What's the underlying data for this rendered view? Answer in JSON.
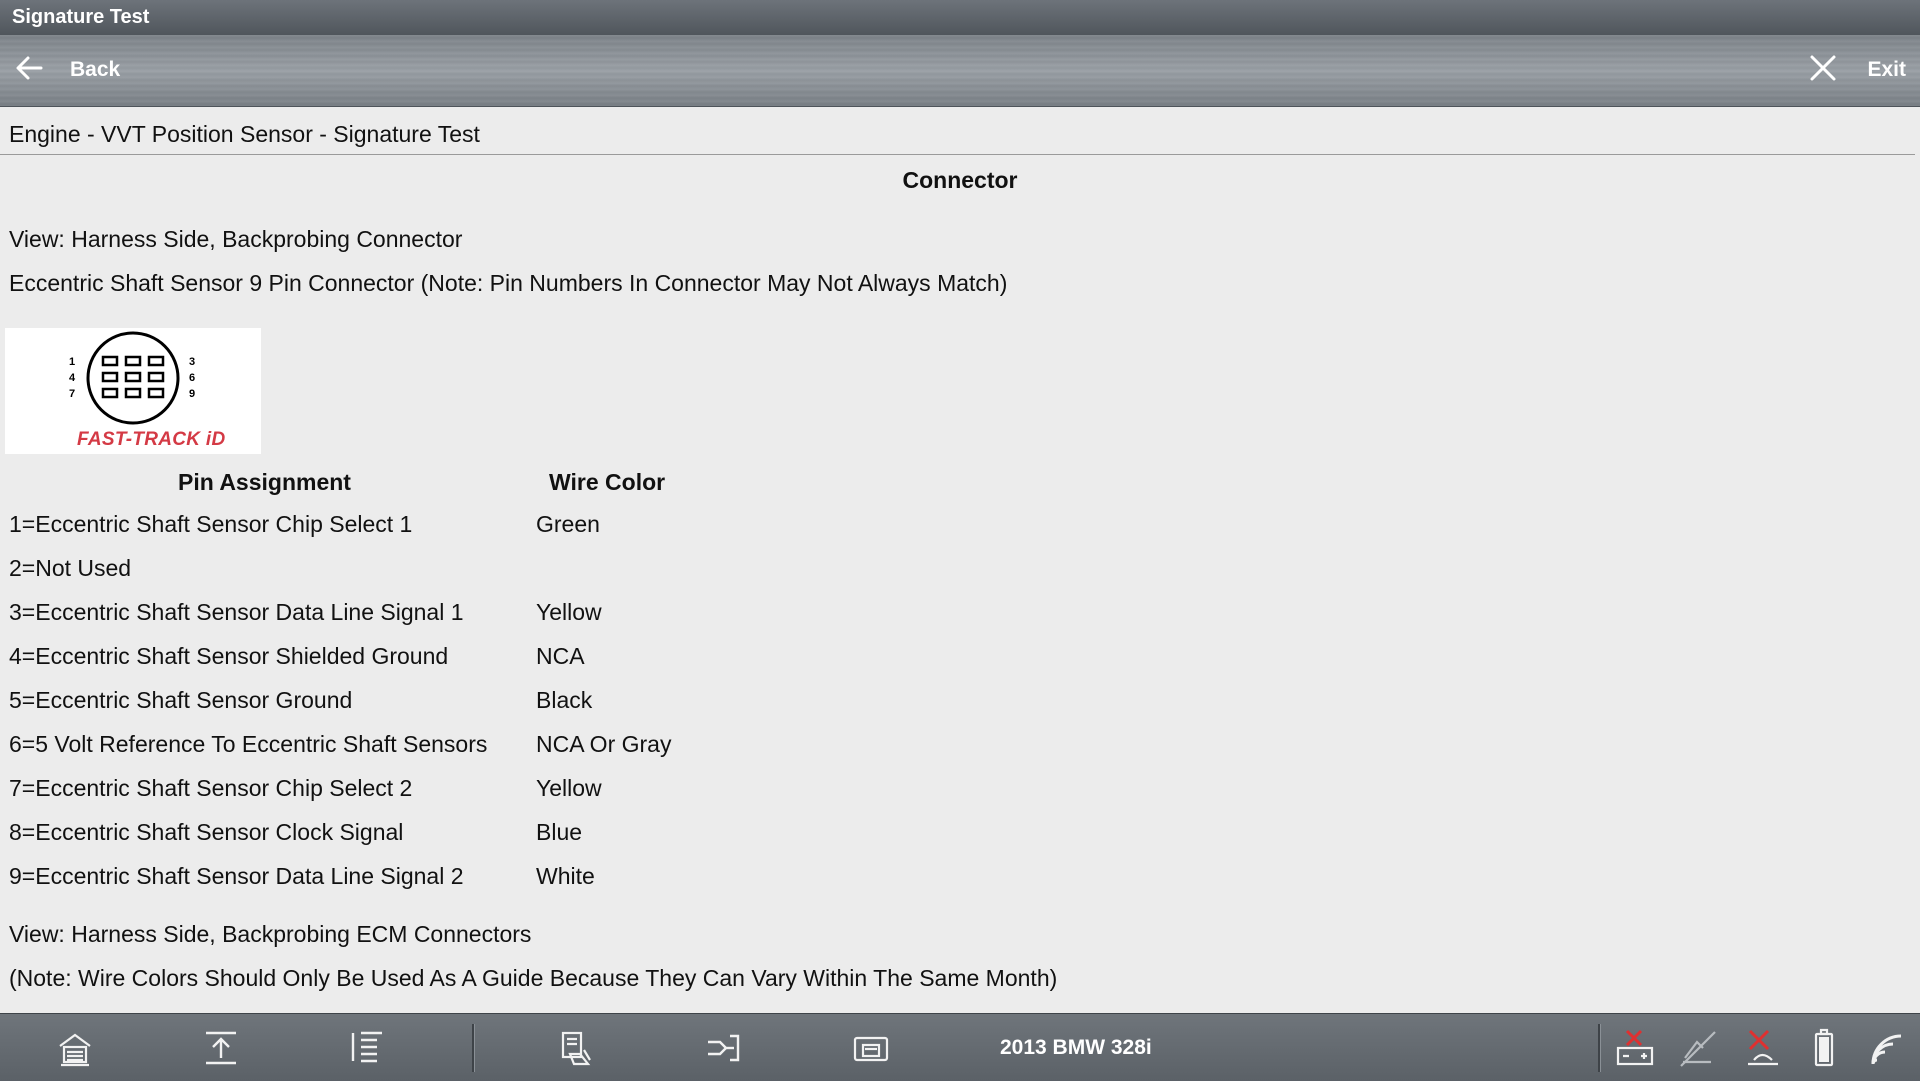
{
  "window": {
    "title": "Signature Test"
  },
  "nav": {
    "back_label": "Back",
    "exit_label": "Exit",
    "back_icon": "arrow-left-icon",
    "exit_icon": "close-icon"
  },
  "breadcrumb": "Engine - VVT Position Sensor - Signature Test",
  "section_title": "Connector",
  "view_line_1": "View: Harness Side, Backprobing Connector",
  "connector_desc": "Eccentric Shaft Sensor 9 Pin Connector (Note: Pin Numbers In Connector May Not Always Match)",
  "image": {
    "brand_text": "FAST-TRACK iD",
    "pin_labels_left": [
      "1",
      "4",
      "7"
    ],
    "pin_labels_right": [
      "3",
      "6",
      "9"
    ]
  },
  "table": {
    "headers": {
      "pin": "Pin Assignment",
      "wire": "Wire Color"
    },
    "rows": [
      {
        "pin": "1=Eccentric Shaft Sensor Chip Select 1",
        "wire": "Green"
      },
      {
        "pin": "2=Not Used",
        "wire": ""
      },
      {
        "pin": "3=Eccentric Shaft Sensor Data Line Signal 1",
        "wire": "Yellow"
      },
      {
        "pin": "4=Eccentric Shaft Sensor Shielded Ground",
        "wire": "NCA"
      },
      {
        "pin": "5=Eccentric Shaft Sensor Ground",
        "wire": "Black"
      },
      {
        "pin": "6=5 Volt Reference To Eccentric Shaft Sensors",
        "wire": "NCA Or Gray"
      },
      {
        "pin": "7=Eccentric Shaft Sensor Chip Select 2",
        "wire": "Yellow"
      },
      {
        "pin": "8=Eccentric Shaft Sensor Clock Signal",
        "wire": "Blue"
      },
      {
        "pin": "9=Eccentric Shaft Sensor Data Line Signal 2",
        "wire": "White"
      }
    ]
  },
  "view_line_2": "View: Harness Side, Backprobing ECM Connectors",
  "note_line": "(Note: Wire Colors Should Only Be Used As A Guide Because They Can Vary Within The Same Month)",
  "toolbar": {
    "vehicle": "2013 BMW 328i",
    "icons": [
      "home-icon",
      "scroll-top-icon",
      "scroll-bottom-icon",
      "print-icon",
      "shortcut-icon",
      "save-icon",
      "battery-disconnected-icon",
      "signal-disconnected-icon",
      "connection-error-icon",
      "battery-level-icon",
      "wifi-icon"
    ]
  },
  "colors": {
    "brand_red": "#d43a45",
    "error_red": "#e03030",
    "toolbar_bg": "#64696f"
  }
}
